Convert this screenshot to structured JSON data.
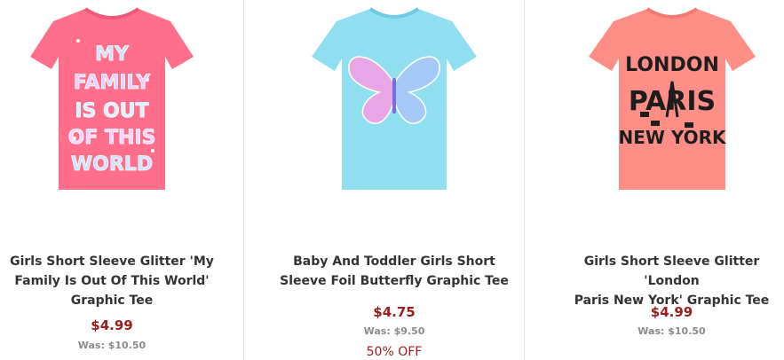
{
  "products": [
    {
      "title_line1": "Girls Short Sleeve Glitter 'My",
      "title_line2": "Family Is Out Of This World'",
      "title_line3": "Graphic Tee",
      "price": "$4.99",
      "was": "Was: $10.50",
      "discount": "",
      "shirt_color": "#ff6f8c",
      "graphic_text": [
        "MY",
        "FAMILY",
        "IS OUT",
        "OF THIS",
        "WORLD"
      ],
      "graphic_color": "#cfe3ff"
    },
    {
      "title_line1": "Baby And Toddler Girls Short",
      "title_line2": "Sleeve Foil Butterfly Graphic Tee",
      "title_line3": "",
      "price": "$4.75",
      "was": "Was: $9.50",
      "discount": "50% OFF",
      "shirt_color": "#8fdff0",
      "graphic_icon": "butterfly-graphic-icon",
      "graphic_color": "#e8a6e6"
    },
    {
      "title_line1": "Girls Short Sleeve Glitter 'London",
      "title_line2": "Paris New York' Graphic Tee",
      "title_line3": "",
      "price": "$4.99",
      "was": "Was: $10.50",
      "discount": "",
      "shirt_color": "#ff8f86",
      "graphic_text": [
        "LONDON",
        "PARIS",
        "NEW YORK"
      ],
      "graphic_color": "#1d1d1d"
    }
  ]
}
